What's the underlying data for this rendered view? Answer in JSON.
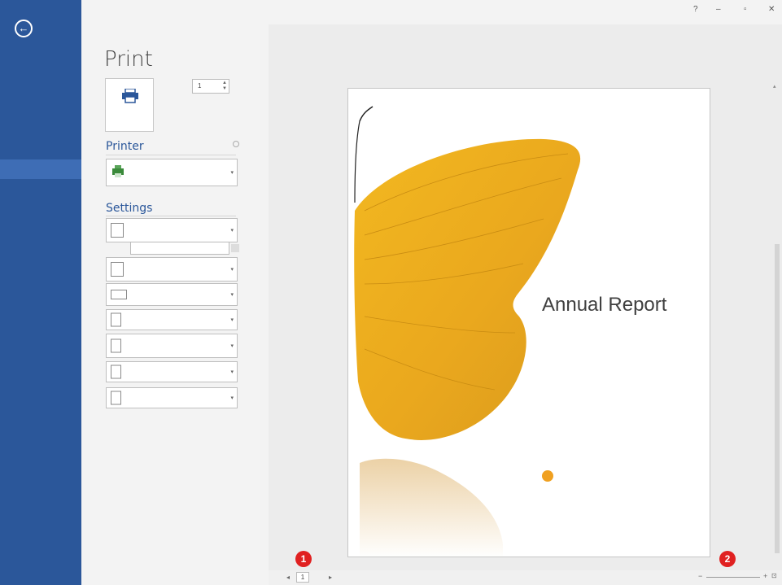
{
  "window": {
    "title": "",
    "sign_in": "",
    "controls": {
      "help": "?",
      "minimize": "–",
      "restore": "▫",
      "close": "✕"
    }
  },
  "sidebar": {
    "back_icon": "back-arrow-icon",
    "items": [
      {
        "label": "",
        "active": false
      },
      {
        "label": "",
        "active": false
      },
      {
        "label": "",
        "active": false
      },
      {
        "label": "",
        "active": false
      },
      {
        "label": "",
        "active": false
      },
      {
        "label": "",
        "active": true
      },
      {
        "label": "",
        "active": false
      },
      {
        "label": "",
        "active": false
      },
      {
        "label": "",
        "active": false
      },
      {
        "label": "",
        "active": false
      },
      {
        "label": "",
        "active": false
      },
      {
        "label": "",
        "active": false
      }
    ],
    "colors": {
      "background": "#2b579a",
      "active": "#3e6db5"
    }
  },
  "print_panel": {
    "heading": "Print",
    "print_button_label": "",
    "copies_label": "",
    "copies_value": "1",
    "printer": {
      "heading": "Printer",
      "name": "",
      "status": "",
      "properties_link": ""
    },
    "settings": {
      "heading": "Settings",
      "pages_label": "",
      "pages_value": "",
      "page_setup_link": "",
      "options": [
        {
          "main": "",
          "sub": ""
        },
        {
          "main": "",
          "sub": ""
        },
        {
          "main": "",
          "sub": ""
        },
        {
          "main": "",
          "sub": ""
        },
        {
          "main": "",
          "sub": ""
        },
        {
          "main": "",
          "sub": ""
        },
        {
          "main": "",
          "sub": ""
        }
      ]
    }
  },
  "preview": {
    "report_title": "Annual Report",
    "author": "",
    "course_title": "",
    "instructor": ""
  },
  "statusbar": {
    "current_page": "1",
    "page_of": "",
    "zoom": "",
    "prev": "◂",
    "next": "▸",
    "zoom_minus": "−",
    "zoom_plus": "+",
    "zoom_fit": "⊡"
  },
  "callouts": {
    "one": "1",
    "two": "2"
  }
}
